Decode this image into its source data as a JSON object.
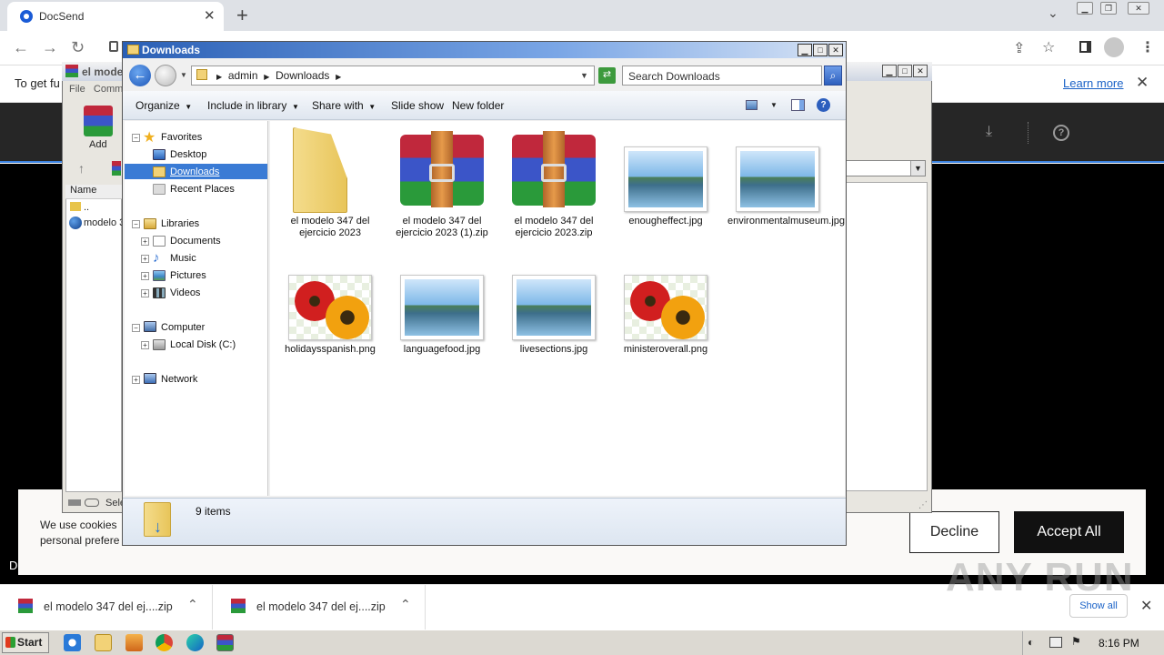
{
  "browser": {
    "tab_title": "DocSend",
    "tab_close": "✕",
    "new_tab": "+",
    "infobar_text": "To get fu",
    "learn_more": "Learn more"
  },
  "page": {
    "cookie_text": "We use cookies personal prefere",
    "decline": "Decline",
    "accept_all": "Accept All",
    "bottom_letter": "D"
  },
  "downloads": {
    "items": [
      {
        "name": "el modelo 347 del ej....zip"
      },
      {
        "name": "el modelo 347 del ej....zip"
      }
    ],
    "show_all": "Show all"
  },
  "watermark": "ANY RUN",
  "winrar": {
    "title": "el mode",
    "menu": "File   Comm",
    "add_label": "Add",
    "col_name": "Name",
    "row_up": "..",
    "row_file": "modelo 3",
    "status": "Sele"
  },
  "explorer": {
    "title": "Downloads",
    "address": [
      "admin",
      "Downloads"
    ],
    "search_placeholder": "Search Downloads",
    "commands": [
      "Organize",
      "Include in library",
      "Share with",
      "Slide show",
      "New folder"
    ],
    "nav": {
      "favorites": "Favorites",
      "desktop": "Desktop",
      "downloads": "Downloads",
      "recent": "Recent Places",
      "libraries": "Libraries",
      "documents": "Documents",
      "music": "Music",
      "pictures": "Pictures",
      "videos": "Videos",
      "computer": "Computer",
      "localdisk": "Local Disk (C:)",
      "network": "Network"
    },
    "files": [
      {
        "name": "el modelo 347 del ejercicio 2023",
        "type": "folder"
      },
      {
        "name": "el modelo 347 del ejercicio 2023 (1).zip",
        "type": "rar"
      },
      {
        "name": "el modelo 347 del ejercicio 2023.zip",
        "type": "rar"
      },
      {
        "name": "enougheffect.jpg",
        "type": "landscape"
      },
      {
        "name": "environmentalmuseum.jpg",
        "type": "landscape"
      },
      {
        "name": "holidaysspanish.png",
        "type": "flower"
      },
      {
        "name": "languagefood.jpg",
        "type": "landscape"
      },
      {
        "name": "livesections.jpg",
        "type": "landscape"
      },
      {
        "name": "ministeroverall.png",
        "type": "flower"
      }
    ],
    "status": "9 items"
  },
  "taskbar": {
    "start": "Start",
    "clock": "8:16 PM"
  }
}
